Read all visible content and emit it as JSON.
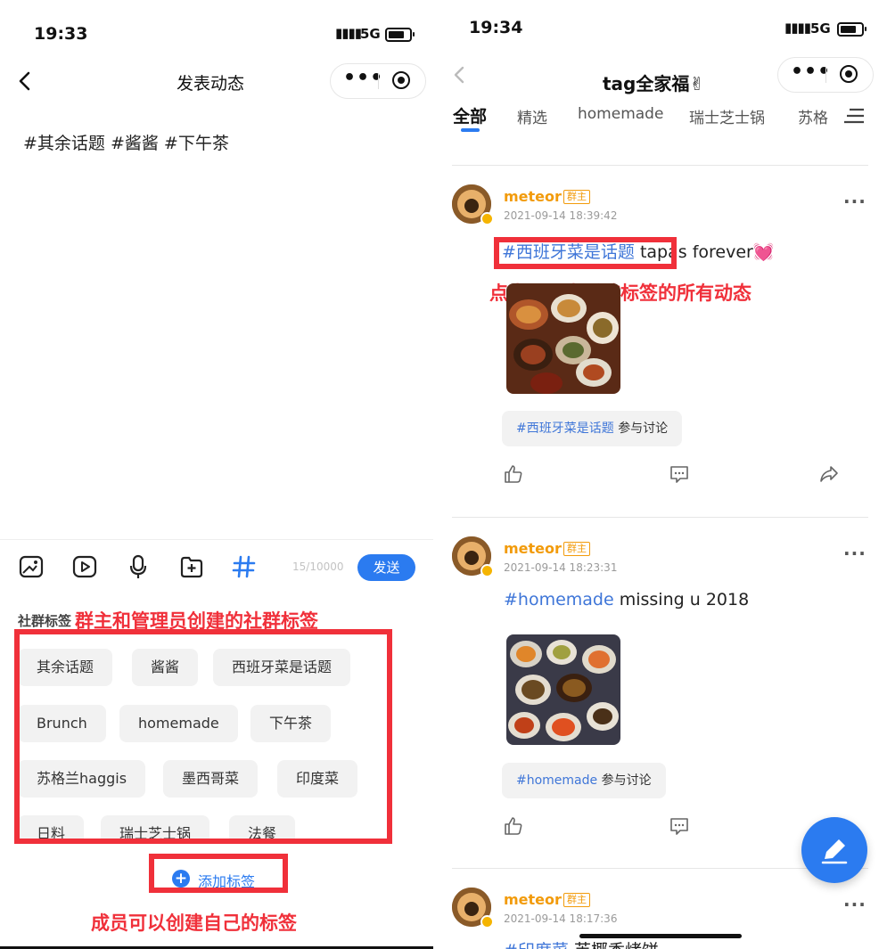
{
  "left": {
    "status": {
      "time": "19:33",
      "network": "5G"
    },
    "nav": {
      "title": "发表动态"
    },
    "composer": {
      "text": "#其余话题 #酱酱 #下午茶",
      "counter": "15/10000",
      "send_label": "发送"
    },
    "tag_section": {
      "label": "社群标签",
      "tags": [
        "其余话题",
        "酱酱",
        "西班牙菜是话题",
        "Brunch",
        "homemade",
        "下午茶",
        "苏格兰haggis",
        "墨西哥菜",
        "印度菜",
        "日料",
        "瑞士芝士锅",
        "法餐"
      ],
      "add_label": "添加标签"
    },
    "annotations": {
      "top": "群主和管理员创建的社群标签",
      "bottom": "成员可以创建自己的标签"
    }
  },
  "right": {
    "status": {
      "time": "19:34",
      "network": "5G"
    },
    "nav": {
      "title": "tag全家福✌"
    },
    "tabs": [
      "全部",
      "精选",
      "homemade",
      "瑞士芝士锅",
      "苏格"
    ],
    "annotation": "点击可以查看该标签的所有动态",
    "posts": [
      {
        "author": "meteor",
        "badge": "群主",
        "time": "2021-09-14 18:39:42",
        "hashtag": "#西班牙菜是话题",
        "text": " tapas forever💓",
        "topic": "#西班牙菜是话题",
        "join": "参与讨论"
      },
      {
        "author": "meteor",
        "badge": "群主",
        "time": "2021-09-14 18:23:31",
        "hashtag": "#homemade",
        "text": " missing u 2018",
        "topic": "#homemade",
        "join": "参与讨论"
      },
      {
        "author": "meteor",
        "badge": "群主",
        "time": "2021-09-14 18:17:36",
        "hashtag": "#印度菜",
        "text": " 芙椰香烤饼",
        "topic": "",
        "join": ""
      }
    ]
  },
  "colors": {
    "accent_blue": "#2b7bf0",
    "annotation_red": "#f0303a",
    "author_orange": "#f29b0b",
    "hashtag_blue": "#3f76d8"
  }
}
